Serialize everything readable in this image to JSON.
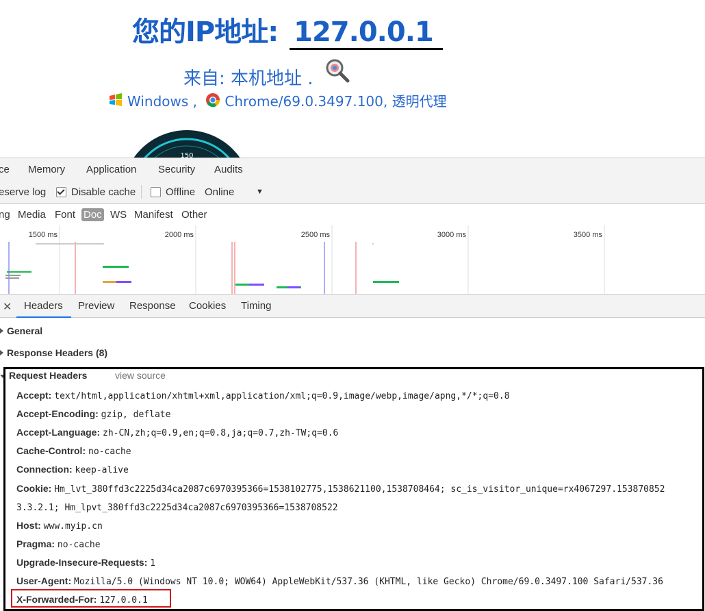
{
  "page": {
    "ip_label": "您的IP地址:",
    "ip_value": "127.0.0.1",
    "from_text": "来自: 本机地址 .",
    "os": "Windows ,",
    "browser": "Chrome/69.0.3497.100, 透明代理",
    "gauge_text": "150"
  },
  "devtools": {
    "panel_tabs": [
      "ce",
      "Memory",
      "Application",
      "Security",
      "Audits"
    ],
    "toolbar": {
      "preserve_log": "eserve log",
      "disable_cache": "Disable cache",
      "disable_cache_checked": true,
      "offline": "Offline",
      "offline_checked": false,
      "throttle": "Online"
    },
    "filters": [
      "ng",
      "Media",
      "Font",
      "Doc",
      "WS",
      "Manifest",
      "Other"
    ],
    "active_filter": "Doc",
    "timeline_ticks": [
      "1500 ms",
      "2000 ms",
      "2500 ms",
      "3000 ms",
      "3500 ms"
    ],
    "detail_tabs": [
      "Headers",
      "Preview",
      "Response",
      "Cookies",
      "Timing"
    ],
    "selected_detail_tab": "Headers",
    "sections": {
      "general": "General",
      "response_headers": "Response Headers (8)",
      "request_headers": "Request Headers",
      "view_source": "view source"
    },
    "request_headers": [
      {
        "name": "Accept:",
        "value": "text/html,application/xhtml+xml,application/xml;q=0.9,image/webp,image/apng,*/*;q=0.8"
      },
      {
        "name": "Accept-Encoding:",
        "value": "gzip, deflate"
      },
      {
        "name": "Accept-Language:",
        "value": "zh-CN,zh;q=0.9,en;q=0.8,ja;q=0.7,zh-TW;q=0.6"
      },
      {
        "name": "Cache-Control:",
        "value": "no-cache"
      },
      {
        "name": "Connection:",
        "value": "keep-alive"
      },
      {
        "name": "Cookie:",
        "value": "Hm_lvt_380ffd3c2225d34ca2087c6970395366=1538102775,1538621100,1538708464; sc_is_visitor_unique=rx4067297.153870852"
      },
      {
        "name": "",
        "value": "3.3.2.1; Hm_lpvt_380ffd3c2225d34ca2087c6970395366=1538708522"
      },
      {
        "name": "Host:",
        "value": "www.myip.cn"
      },
      {
        "name": "Pragma:",
        "value": "no-cache"
      },
      {
        "name": "Upgrade-Insecure-Requests:",
        "value": "1"
      },
      {
        "name": "User-Agent:",
        "value": "Mozilla/5.0 (Windows NT 10.0; WOW64) AppleWebKit/537.36 (KHTML, like Gecko) Chrome/69.0.3497.100 Safari/537.36"
      },
      {
        "name": "X-Forwarded-For:",
        "value": "127.0.0.1"
      }
    ],
    "colors": {
      "title_blue": "#1a5fc4",
      "link_blue": "#2a6acf",
      "highlight_red": "#d0161c",
      "tab_underline": "#1a73e8"
    }
  }
}
